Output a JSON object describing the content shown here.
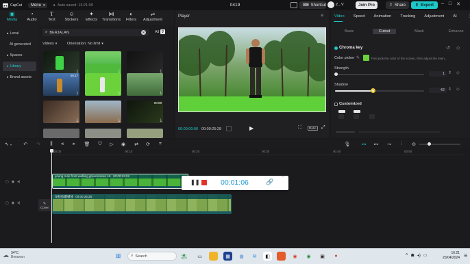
{
  "titlebar": {
    "app_name": "CapCut",
    "menu_label": "Menu",
    "autosave": "Auto saved: 16:21:09",
    "project_name": "0419",
    "shortcut_label": "Shortcut",
    "user_name": "Z...V",
    "join_pro_label": "Join Pro",
    "share_label": "Share",
    "export_label": "Export"
  },
  "media_tools": [
    {
      "label": "Media",
      "icon": "media-icon",
      "active": true
    },
    {
      "label": "Audio",
      "icon": "audio-icon",
      "active": false
    },
    {
      "label": "Text",
      "icon": "text-icon",
      "active": false
    },
    {
      "label": "Stickers",
      "icon": "stickers-icon",
      "active": false
    },
    {
      "label": "Effects",
      "icon": "effects-icon",
      "active": false
    },
    {
      "label": "Transitions",
      "icon": "transitions-icon",
      "active": false
    },
    {
      "label": "Filters",
      "icon": "filters-icon",
      "active": false
    },
    {
      "label": "Adjustment",
      "icon": "adjustment-icon",
      "active": false
    }
  ],
  "left_nav": [
    {
      "label": "Local",
      "active": false
    },
    {
      "label": "AI generated",
      "active": false
    },
    {
      "label": "Spaces",
      "active": false
    },
    {
      "label": "Library",
      "active": true
    },
    {
      "label": "Brand assets",
      "active": false
    }
  ],
  "media": {
    "search_value": "BERJALAN",
    "all_filter": "All",
    "filter_type": "Videos",
    "filter_orientation": "Orientation: No limit",
    "thumb_durations": [
      "",
      "",
      "",
      "00:17",
      "",
      "",
      "",
      "",
      "00:09",
      "",
      "",
      ""
    ]
  },
  "player": {
    "title": "Player",
    "current_time": "00:00:00:00",
    "total_time": "00:00:25:28",
    "ratio_label": "Ratio"
  },
  "right_panel": {
    "tabs": [
      "Video",
      "Speed",
      "Animation",
      "Tracking",
      "Adjustment",
      "AI"
    ],
    "active_tab": "Video",
    "subtabs": [
      "Basic",
      "Cutout",
      "Mask",
      "Enhance"
    ],
    "active_subtab": "Cutout",
    "chroma_key_label": "Chroma key",
    "color_picker_label": "Color picker",
    "color_picker_hint": "First pick the color of the screen, then adjust the inten...",
    "strength_label": "Strength",
    "strength_value": "1",
    "shadow_label": "Shadow",
    "shadow_value": "42",
    "customized_label": "Customized",
    "strength_fraction": 0.01,
    "shadow_fraction": 0.42,
    "picked_color": "#6cd13a"
  },
  "timeline": {
    "ruler_marks": [
      "00:00",
      "00:10",
      "00:20",
      "00:30",
      "00:40",
      "00:50"
    ],
    "clip1_title": "young man front walking greenscreen 4K",
    "clip1_duration": "00:00:19:22",
    "clip2_title": "龙拉拉跟帧体",
    "clip2_duration": "00:00:25:28",
    "cover_label": "Cover"
  },
  "recorder": {
    "time": "00:01:06"
  },
  "taskbar": {
    "temperature": "34°C",
    "weather": "Berawan",
    "search_placeholder": "Search",
    "time": "16:21",
    "date": "20/04/2024"
  }
}
